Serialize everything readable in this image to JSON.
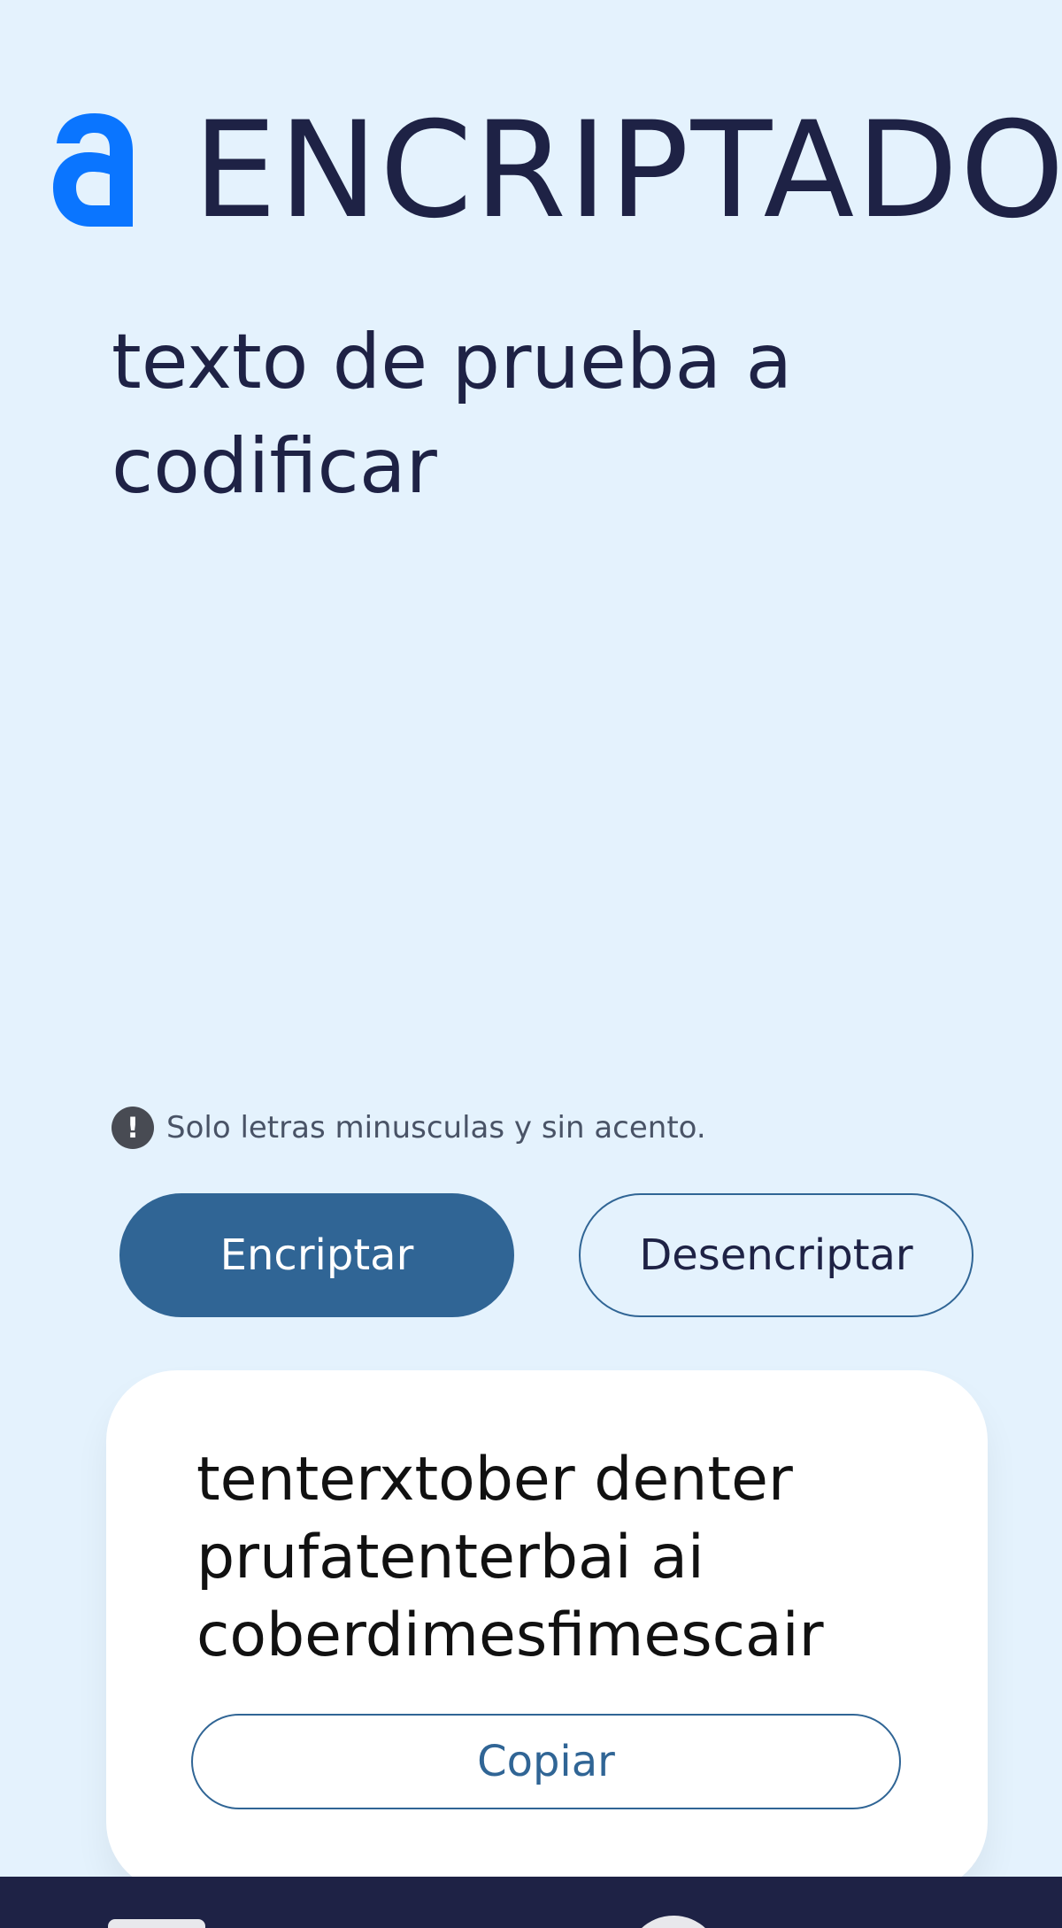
{
  "header": {
    "logo_icon": "alura-a-logo-icon",
    "logo_color": "#0a75ff",
    "title": "ENCRIPTADO"
  },
  "input": {
    "value": "texto de prueba a codificar",
    "placeholder": ""
  },
  "hint": {
    "icon": "exclamation-icon",
    "icon_glyph": "!",
    "text": "Solo letras minusculas y sin acento."
  },
  "actions": {
    "encrypt_label": "Encriptar",
    "decrypt_label": "Desencriptar"
  },
  "output": {
    "text": "tenterxtober denter prufatenterbai ai coberdimesfimescair",
    "copy_label": "Copiar"
  },
  "colors": {
    "background": "#e4f2fd",
    "text_dark": "#1e2245",
    "primary": "#306595",
    "card": "#ffffff",
    "footer": "#1e2245"
  }
}
